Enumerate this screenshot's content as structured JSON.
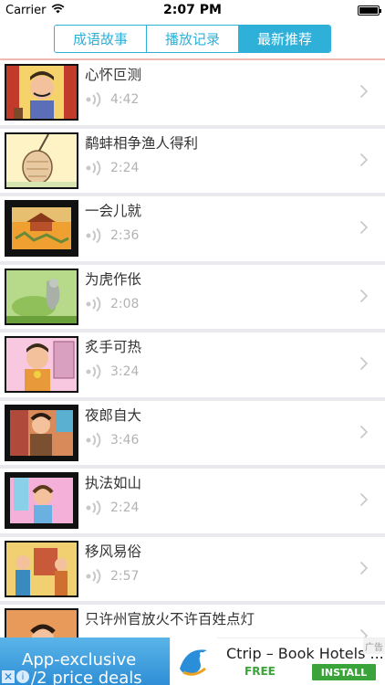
{
  "status_bar": {
    "carrier": "Carrier",
    "time": "2:07 PM",
    "battery_level": 1.0
  },
  "tabs": [
    {
      "label": "成语故事",
      "active": false
    },
    {
      "label": "播放记录",
      "active": false
    },
    {
      "label": "最新推荐",
      "active": true
    }
  ],
  "stories": [
    {
      "title": "心怀叵测",
      "duration": "4:42"
    },
    {
      "title": "鹬蚌相争渔人得利",
      "duration": "2:24"
    },
    {
      "title": "一会儿就",
      "duration": "2:36"
    },
    {
      "title": "为虎作伥",
      "duration": "2:08"
    },
    {
      "title": "炙手可热",
      "duration": "3:24"
    },
    {
      "title": "夜郎自大",
      "duration": "3:46"
    },
    {
      "title": "执法如山",
      "duration": "2:24"
    },
    {
      "title": "移风易俗",
      "duration": "2:57"
    },
    {
      "title": "只许州官放火不许百姓点灯",
      "duration": ""
    }
  ],
  "ad": {
    "line1": "App-exclusive",
    "line2": "/2 price deals",
    "title": "Ctrip – Book Hotels ...",
    "free": "FREE",
    "install": "INSTALL",
    "tag": "广告",
    "close": "✕",
    "info": "i"
  },
  "colors": {
    "accent": "#2eb0d9",
    "separator": "#e9e9ee",
    "install": "#3aa33a"
  }
}
